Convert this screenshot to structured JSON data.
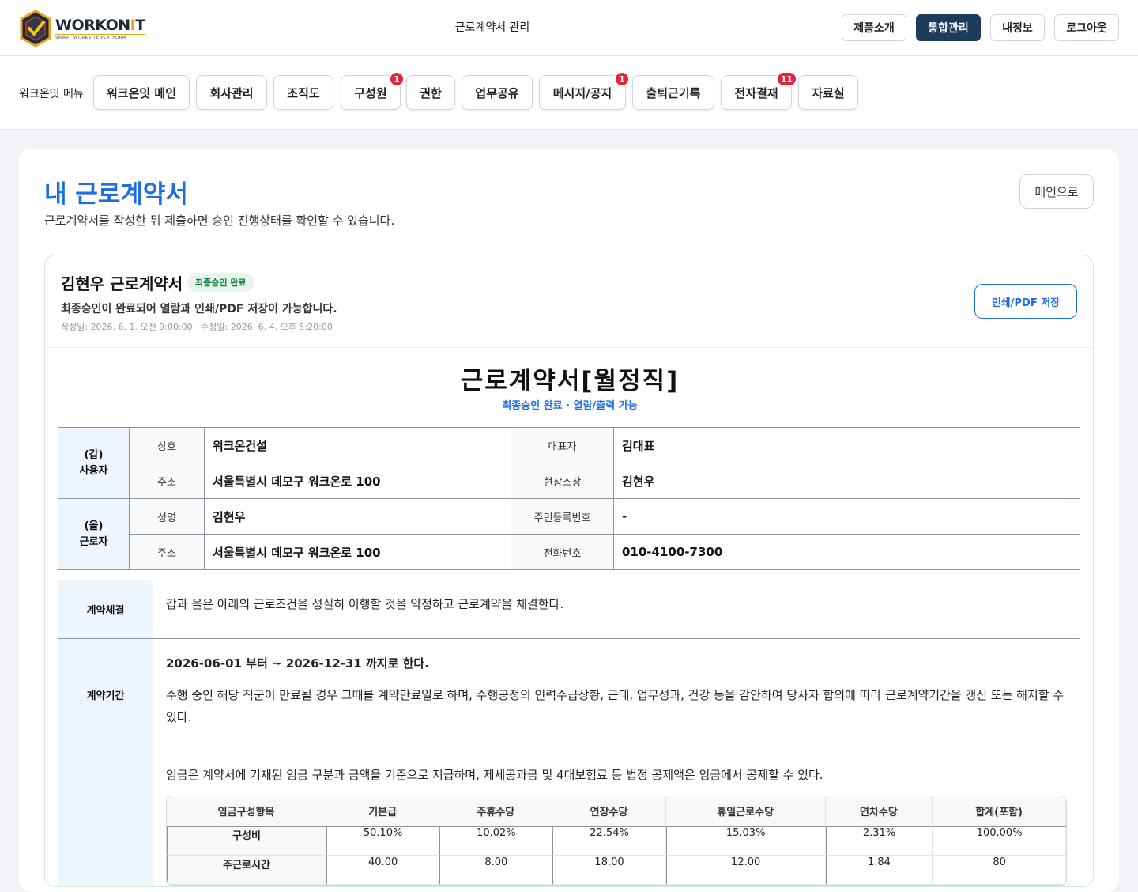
{
  "header": {
    "logo_word_main": "WORKON",
    "logo_word_accent": "I",
    "logo_word_end": "T",
    "logo_tagline": "SMART WORKSITE PLATFORM",
    "page_label": "근로계약서 관리",
    "buttons": [
      "제품소개",
      "통합관리",
      "내정보",
      "로그아웃"
    ]
  },
  "menu": {
    "title": "워크온잇 메뉴",
    "items": [
      {
        "label": "워크온잇 메인",
        "badge": ""
      },
      {
        "label": "회사관리",
        "badge": ""
      },
      {
        "label": "조직도",
        "badge": ""
      },
      {
        "label": "구성원",
        "badge": "1"
      },
      {
        "label": "권한",
        "badge": ""
      },
      {
        "label": "업무공유",
        "badge": ""
      },
      {
        "label": "메시지/공지",
        "badge": "1"
      },
      {
        "label": "출퇴근기록",
        "badge": ""
      },
      {
        "label": "전자결재",
        "badge": "11"
      },
      {
        "label": "자료실",
        "badge": ""
      }
    ]
  },
  "page": {
    "title": "내 근로계약서",
    "subtitle": "근로계약서를 작성한 뒤 제출하면 승인 진행상태를 확인할 수 있습니다.",
    "main_button": "메인으로"
  },
  "contract": {
    "name": "김현우 근로계약서",
    "status": "최종승인 완료",
    "note": "최종승인이 완료되어 열람과 인쇄/PDF 저장이 가능합니다.",
    "dates": "작성일: 2026. 6. 1. 오전 9:00:00 · 수정일: 2026. 6. 4. 오후 5:20:00",
    "print_button": "인쇄/PDF 저장",
    "doc_title": "근로계약서[월정직]",
    "doc_subtitle": "최종승인 완료 · 열람/출력 가능",
    "employer": {
      "group_line1": "(갑)",
      "group_line2": "사용자",
      "company_label": "상호",
      "company": "워크온건설",
      "ceo_label": "대표자",
      "ceo": "김대표",
      "address_label": "주소",
      "address": "서울특별시 데모구 워크온로 100",
      "manager_label": "현장소장",
      "manager": "김현우"
    },
    "employee": {
      "group_line1": "(을)",
      "group_line2": "근로자",
      "name_label": "성명",
      "name": "김현우",
      "rrn_label": "주민등록번호",
      "rrn": "-",
      "address_label": "주소",
      "address": "서울특별시 데모구 워크온로 100",
      "phone_label": "전화번호",
      "phone": "010-4100-7300"
    },
    "terms": {
      "agreement_label": "계약체결",
      "agreement_text": "갑과 을은 아래의 근로조건을 성실히 이행할 것을 약정하고 근로계약을 체결한다.",
      "period_label": "계약기간",
      "period_text": "2026-06-01 부터 ~ 2026-12-31 까지로 한다.",
      "period_note": "수행 중인 해당 직군이 만료될 경우 그때를 계약만료일로 하며, 수행공정의 인력수급상황, 근태, 업무성과, 건강 등을 감안하여 당사자 합의에 따라 근로계약기간을 갱신 또는 해지할 수 있다.",
      "wage_text": "임금은 계약서에 기재된 임금 구분과 금액을 기준으로 지급하며, 제세공과금 및 4대보험료 등 법정 공제액은 임금에서 공제할 수 있다."
    },
    "wage_table": {
      "headers": [
        "임금구성항목",
        "기본급",
        "주휴수당",
        "연장수당",
        "휴일근로수당",
        "연차수당",
        "합계(포함)"
      ],
      "rows": [
        [
          "구성비",
          "50.10%",
          "10.02%",
          "22.54%",
          "15.03%",
          "2.31%",
          "100.00%"
        ],
        [
          "주근로시간",
          "40.00",
          "8.00",
          "18.00",
          "12.00",
          "1.84",
          "80"
        ]
      ]
    }
  },
  "colors": {
    "accent_blue": "#1d6de5",
    "nav_dark": "#1d3c5c",
    "badge_red": "#e5243b",
    "status_green": "#14803c"
  }
}
